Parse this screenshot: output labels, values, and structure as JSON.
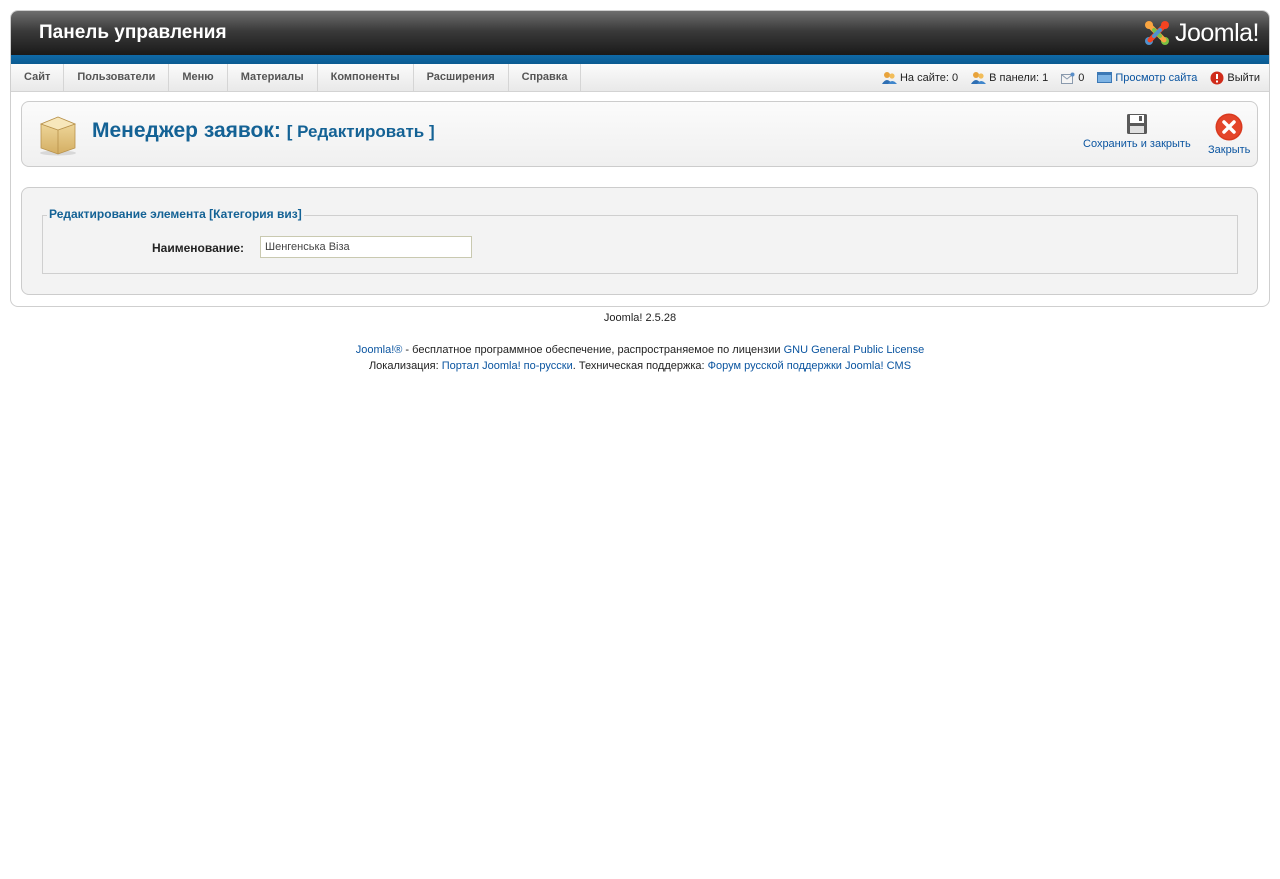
{
  "header": {
    "title": "Панель управления",
    "logo_text": "Joomla!"
  },
  "menu": {
    "items": [
      {
        "label": "Сайт"
      },
      {
        "label": "Пользователи"
      },
      {
        "label": "Меню"
      },
      {
        "label": "Материалы"
      },
      {
        "label": "Компоненты"
      },
      {
        "label": "Расширения"
      },
      {
        "label": "Справка"
      }
    ]
  },
  "status": {
    "on_site": "На сайте: 0",
    "in_panel": "В панели: 1",
    "messages": "0",
    "view_site": "Просмотр сайта",
    "logout": "Выйти"
  },
  "toolbar": {
    "title": "Менеджер заявок:",
    "subtitle": "[ Редактировать ]",
    "save_close": "Сохранить и закрыть",
    "close": "Закрыть"
  },
  "form": {
    "legend": "Редактирование элемента [Категория виз]",
    "name_label": "Наименование:",
    "name_value": "Шенгенська Віза"
  },
  "footer": {
    "version": "Joomla! 2.5.28",
    "link1": "Joomla!®",
    "text1": " - бесплатное программное обеспечение, распространяемое по лицензии ",
    "link2": "GNU General Public License",
    "text2": "Локализация: ",
    "link3": "Портал Joomla! по-русски",
    "text3": ". Техническая поддержка: ",
    "link4": "Форум русской поддержки Joomla! CMS"
  },
  "colors": {
    "accent": "#146295",
    "blue_bar": "#0f6aa8",
    "link": "#0b55a0",
    "close_red": "#d9391e"
  },
  "icons": [
    "joomla-logo-icon",
    "users-online-icon",
    "users-panel-icon",
    "messages-icon",
    "view-site-icon",
    "logout-icon",
    "package-icon",
    "save-icon",
    "close-icon"
  ]
}
